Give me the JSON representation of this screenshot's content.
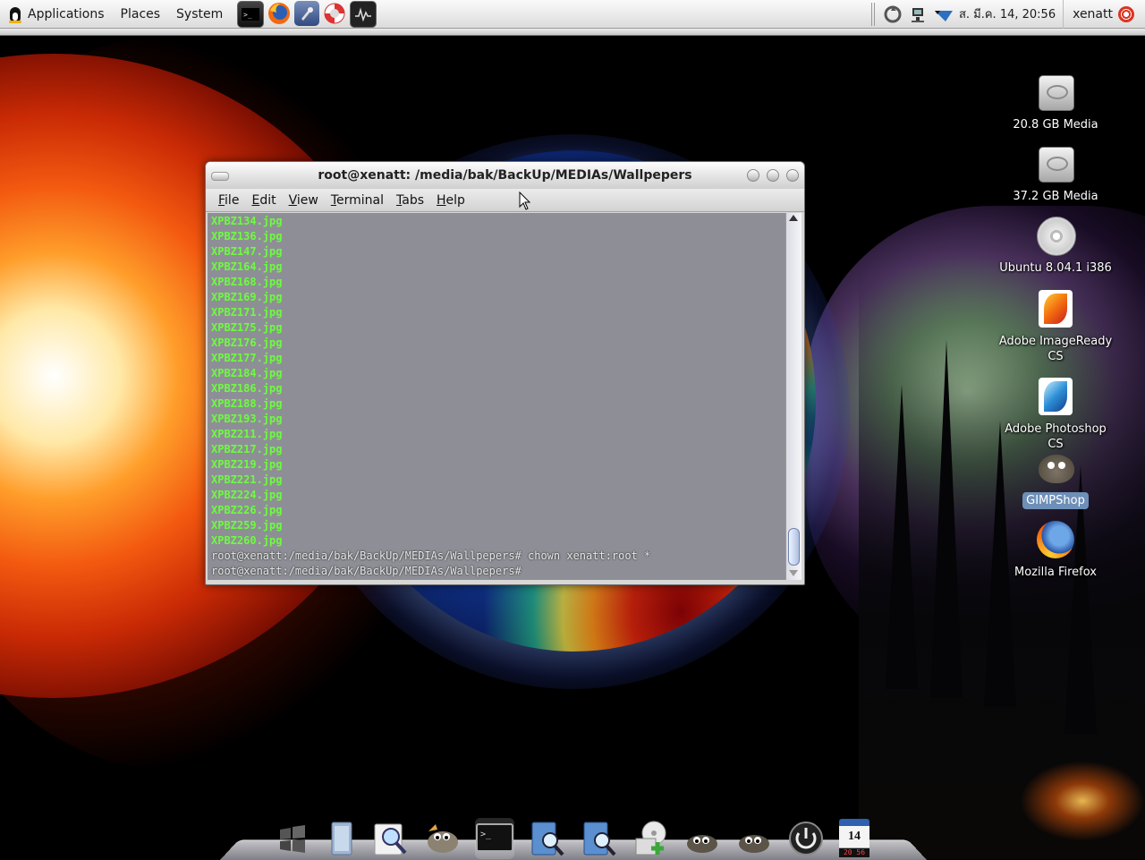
{
  "top_panel": {
    "menus": [
      "Applications",
      "Places",
      "System"
    ],
    "launchers": [
      "terminal-icon",
      "firefox-icon",
      "system-settings-icon",
      "help-lifebuoy-icon",
      "system-monitor-icon"
    ],
    "tray_icons": [
      "update-notifier-icon",
      "network-icon",
      "volume-icon"
    ],
    "clock": "ส. มี.ค. 14, 20:56",
    "user": "xenatt"
  },
  "desktop_icons": [
    {
      "label": "20.8 GB Media",
      "icon": "hard-drive-icon"
    },
    {
      "label": "37.2 GB Media",
      "icon": "hard-drive-icon"
    },
    {
      "label": "Ubuntu 8.04.1 i386",
      "icon": "cd-icon"
    },
    {
      "label": "Adobe ImageReady CS",
      "icon": "imageready-icon"
    },
    {
      "label": "Adobe Photoshop CS",
      "icon": "photoshop-icon"
    },
    {
      "label": "GIMPShop",
      "icon": "gimp-icon",
      "selected": true
    },
    {
      "label": "Mozilla Firefox",
      "icon": "firefox-icon"
    }
  ],
  "terminal": {
    "title": "root@xenatt: /media/bak/BackUp/MEDIAs/Wallpepers",
    "menu": [
      "File",
      "Edit",
      "View",
      "Terminal",
      "Tabs",
      "Help"
    ],
    "files": [
      "XPBZ134.jpg",
      "XPBZ136.jpg",
      "XPBZ147.jpg",
      "XPBZ164.jpg",
      "XPBZ168.jpg",
      "XPBZ169.jpg",
      "XPBZ171.jpg",
      "XPBZ175.jpg",
      "XPBZ176.jpg",
      "XPBZ177.jpg",
      "XPBZ184.jpg",
      "XPBZ186.jpg",
      "XPBZ188.jpg",
      "XPBZ193.jpg",
      "XPBZ211.jpg",
      "XPBZ217.jpg",
      "XPBZ219.jpg",
      "XPBZ221.jpg",
      "XPBZ224.jpg",
      "XPBZ226.jpg",
      "XPBZ259.jpg",
      "XPBZ260.jpg"
    ],
    "command_line": "root@xenatt:/media/bak/BackUp/MEDIAs/Wallpepers# chown xenatt:root *",
    "prompt_line": "root@xenatt:/media/bak/BackUp/MEDIAs/Wallpepers#",
    "file_color": "#6dfc3e"
  },
  "dock": {
    "items": [
      "windows-icon",
      "folder-icon",
      "search-icon",
      "gimp-icon",
      "terminal-icon",
      "finder-search-icon",
      "finder-search-icon",
      "install-disc-icon",
      "gimp-icon",
      "gimp-icon",
      "power-icon",
      "calendar-icon"
    ],
    "calendar_day": "14",
    "calendar_time": "20 56"
  }
}
